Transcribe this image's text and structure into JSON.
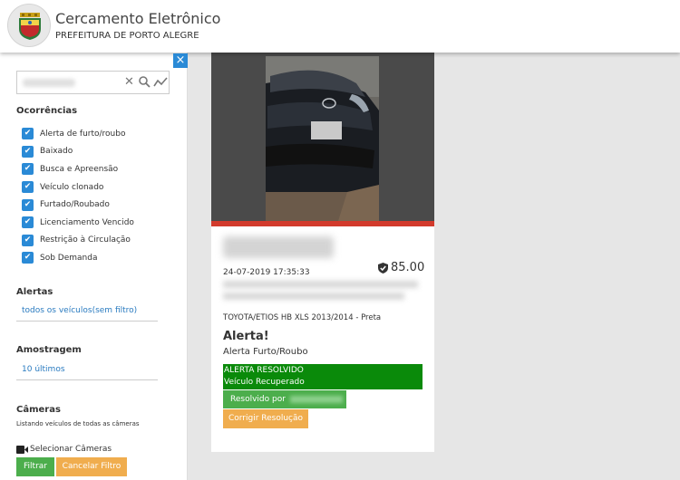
{
  "header": {
    "title": "Cercamento Eletrônico",
    "subtitle": "PREFEITURA DE PORTO ALEGRE",
    "logo_icon": "city-coat-of-arms-icon"
  },
  "sidebar": {
    "close_icon": "×",
    "search": {
      "value": "",
      "placeholder": ""
    },
    "occurrences": {
      "title": "Ocorrências",
      "items": [
        {
          "label": "Alerta de furto/roubo",
          "checked": true
        },
        {
          "label": "Baixado",
          "checked": true
        },
        {
          "label": "Busca e Apreensão",
          "checked": true
        },
        {
          "label": "Veículo clonado",
          "checked": true
        },
        {
          "label": "Furtado/Roubado",
          "checked": true
        },
        {
          "label": "Licenciamento Vencido",
          "checked": true
        },
        {
          "label": "Restrição à Circulação",
          "checked": true
        },
        {
          "label": "Sob Demanda",
          "checked": true
        }
      ]
    },
    "alerts": {
      "title": "Alertas",
      "value": "todos os veículos(sem filtro)"
    },
    "sampling": {
      "title": "Amostragem",
      "value": "10 últimos"
    },
    "cameras": {
      "title": "Câmeras",
      "note": "Listando veículos de todas as câmeras",
      "select_label": "Selecionar Câmeras"
    },
    "buttons": {
      "filter": "Filtrar",
      "cancel": "Cancelar Filtro"
    }
  },
  "card": {
    "datetime": "24-07-2019 17:35:33",
    "score": "85.00",
    "vehicle": "TOYOTA/ETIOS HB XLS 2013/2014 - Preta",
    "alert_title": "Alerta!",
    "alert_type": "Alerta Furto/Roubo",
    "resolved_status": "ALERTA RESOLVIDO",
    "resolved_reason": "Veículo Recuperado",
    "resolved_by": "Resolvido por",
    "correct_button": "Corrigir Resolução"
  },
  "colors": {
    "accent_blue": "#2a8ad6",
    "success_green": "#4cae4c",
    "resolved_green": "#0a8a0a",
    "warning_orange": "#f0ad4e",
    "alert_red": "#d23a2c"
  }
}
